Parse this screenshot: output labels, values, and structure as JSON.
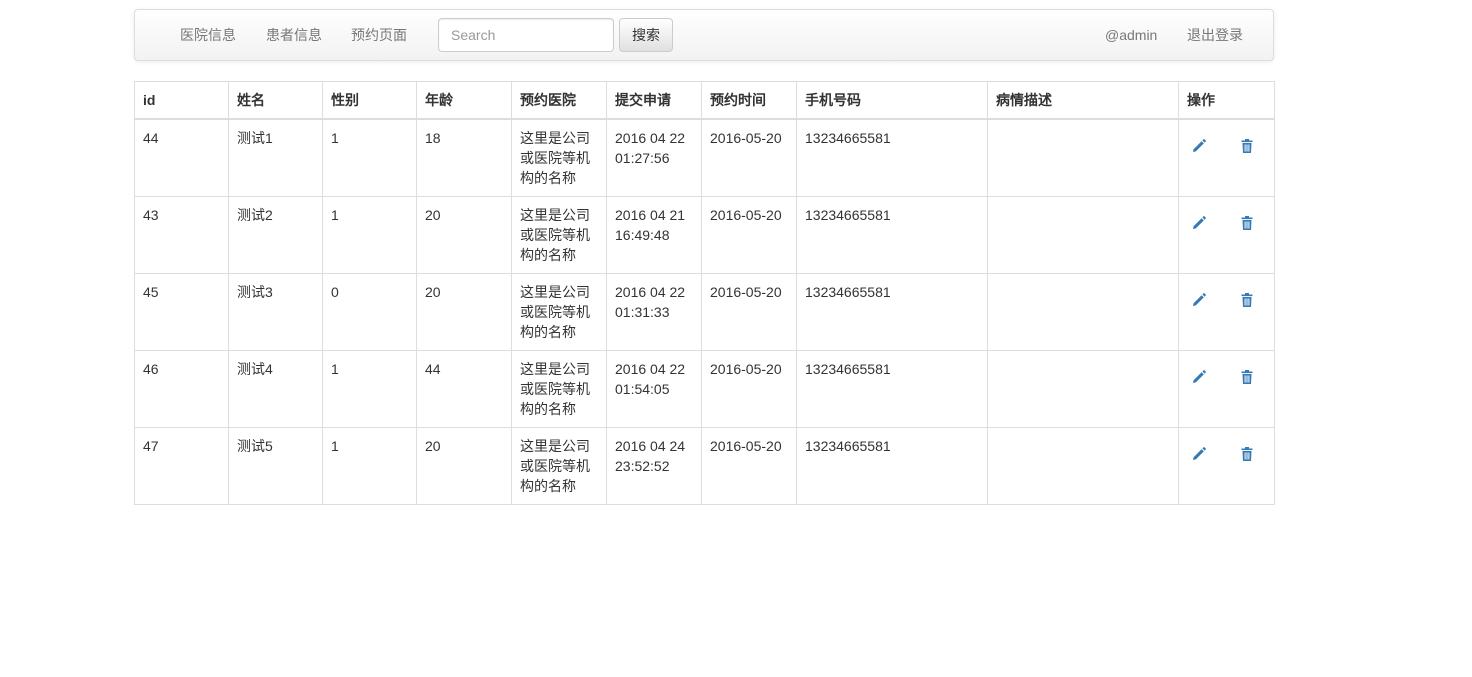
{
  "navbar": {
    "links": [
      "医院信息",
      "患者信息",
      "预约页面"
    ],
    "search": {
      "placeholder": "Search",
      "value": ""
    },
    "search_button": "搜索",
    "user": "@admin",
    "logout": "退出登录"
  },
  "table": {
    "headers": [
      "id",
      "姓名",
      "性别",
      "年龄",
      "预约医院",
      "提交申请",
      "预约时间",
      "手机号码",
      "病情描述",
      "操作"
    ],
    "rows": [
      {
        "id": "44",
        "name": "测试1",
        "gender": "1",
        "age": "18",
        "hospital": "这里是公司或医院等机构的名称",
        "submitted": "2016 04 22 01:27:56",
        "appointment": "2016-05-20",
        "phone": "13234665581",
        "description": ""
      },
      {
        "id": "43",
        "name": "测试2",
        "gender": "1",
        "age": "20",
        "hospital": "这里是公司或医院等机构的名称",
        "submitted": "2016 04 21 16:49:48",
        "appointment": "2016-05-20",
        "phone": "13234665581",
        "description": ""
      },
      {
        "id": "45",
        "name": "测试3",
        "gender": "0",
        "age": "20",
        "hospital": "这里是公司或医院等机构的名称",
        "submitted": "2016 04 22 01:31:33",
        "appointment": "2016-05-20",
        "phone": "13234665581",
        "description": ""
      },
      {
        "id": "46",
        "name": "测试4",
        "gender": "1",
        "age": "44",
        "hospital": "这里是公司或医院等机构的名称",
        "submitted": "2016 04 22 01:54:05",
        "appointment": "2016-05-20",
        "phone": "13234665581",
        "description": ""
      },
      {
        "id": "47",
        "name": "测试5",
        "gender": "1",
        "age": "20",
        "hospital": "这里是公司或医院等机构的名称",
        "submitted": "2016 04 24 23:52:52",
        "appointment": "2016-05-20",
        "phone": "13234665581",
        "description": ""
      }
    ],
    "icons": {
      "edit": "pencil-icon",
      "delete": "trash-icon"
    },
    "icon_color": "#337ab7"
  }
}
